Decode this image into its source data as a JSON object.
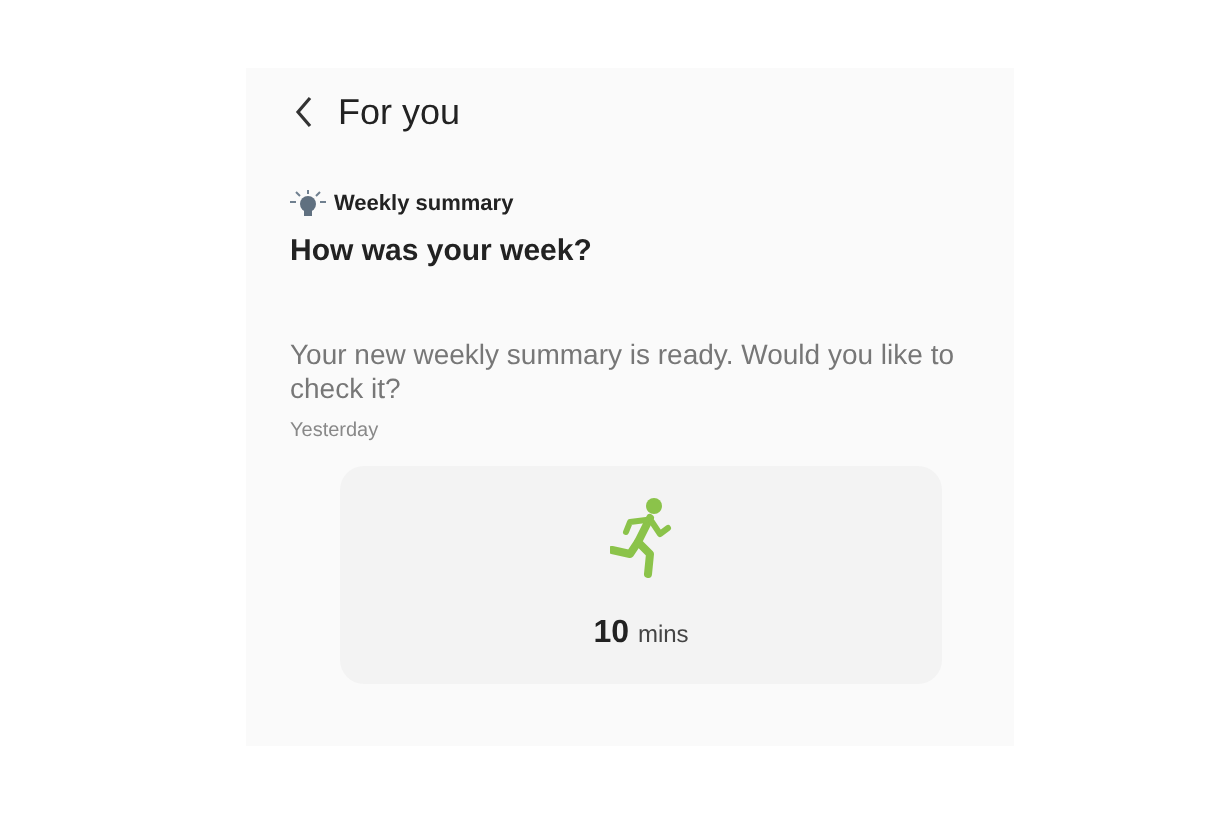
{
  "header": {
    "title": "For you"
  },
  "card": {
    "category": "Weekly summary",
    "heading": "How was your week?",
    "message": "Your new weekly summary is ready. Would you like to check it?",
    "time": "Yesterday"
  },
  "activity": {
    "value": "10",
    "unit": "mins"
  }
}
